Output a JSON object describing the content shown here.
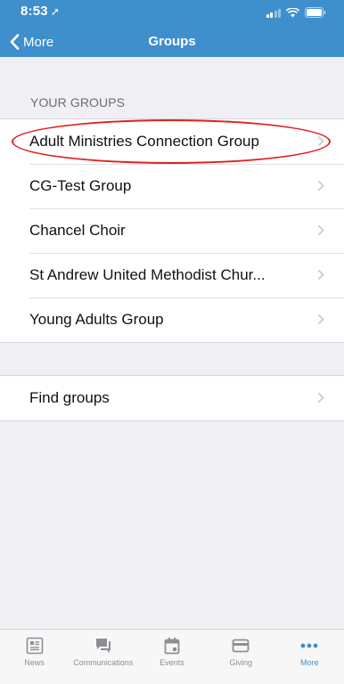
{
  "status_bar": {
    "time": "8:53",
    "location_arrow": "➚"
  },
  "nav": {
    "back_label": "More",
    "title": "Groups"
  },
  "your_groups": {
    "header": "YOUR GROUPS",
    "items": [
      {
        "label": "Adult Ministries Connection Group"
      },
      {
        "label": "CG-Test Group"
      },
      {
        "label": "Chancel Choir"
      },
      {
        "label": "St Andrew United Methodist Chur..."
      },
      {
        "label": "Young Adults Group"
      }
    ]
  },
  "find": {
    "label": "Find groups"
  },
  "tabs": [
    {
      "label": "News",
      "icon": "news-icon"
    },
    {
      "label": "Communications",
      "icon": "chat-icon"
    },
    {
      "label": "Events",
      "icon": "calendar-icon"
    },
    {
      "label": "Giving",
      "icon": "card-icon"
    },
    {
      "label": "More",
      "icon": "more-dots-icon",
      "active": true
    }
  ],
  "colors": {
    "accent": "#3f8fcc",
    "annotation": "#e0201e"
  }
}
